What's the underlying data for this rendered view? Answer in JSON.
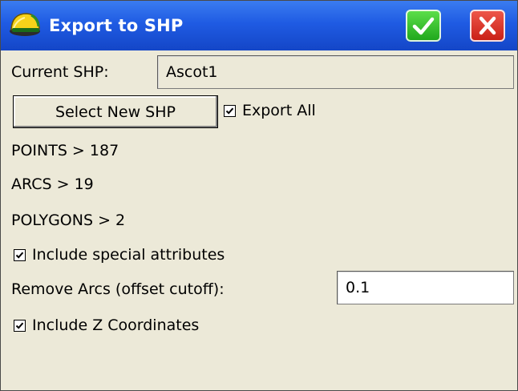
{
  "window": {
    "title": "Export to SHP"
  },
  "current_shp": {
    "label": "Current SHP:",
    "value": "Ascot1"
  },
  "select_button": {
    "label": "Select New SHP"
  },
  "export_all": {
    "label": "Export All",
    "checked": true
  },
  "stats": {
    "points": "POINTS > 187",
    "arcs": "ARCS > 19",
    "polygons": "POLYGONS > 2"
  },
  "include_special": {
    "label": "Include special attributes",
    "checked": true
  },
  "remove_arcs": {
    "label": "Remove Arcs (offset cutoff):",
    "value": "0.1"
  },
  "include_z": {
    "label": "Include Z Coordinates",
    "checked": true
  },
  "colors": {
    "titlebar": "#1f5be3",
    "ok": "#1ea51b",
    "close": "#c81d14",
    "background": "#ece9d8"
  },
  "icons": [
    "app-helmet-icon",
    "checkmark-icon",
    "close-icon",
    "checkbox-check-icon"
  ]
}
